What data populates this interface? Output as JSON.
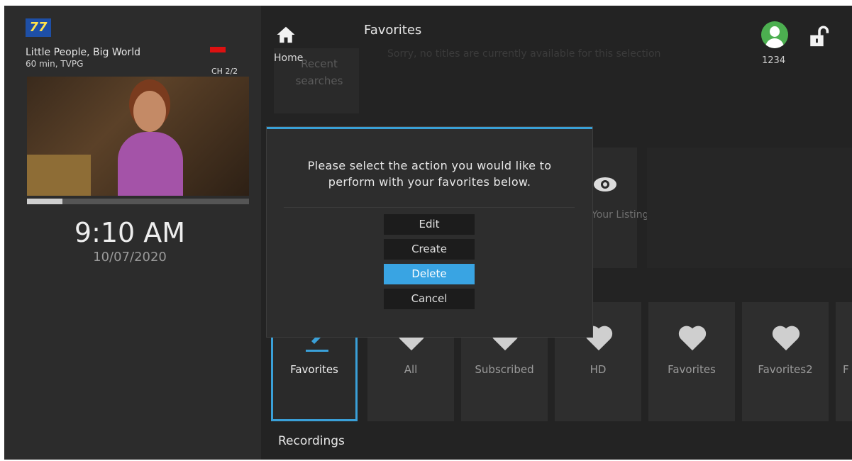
{
  "now_playing": {
    "logo_text": "77",
    "title": "Little People, Big World",
    "meta": "60 min, TVPG",
    "channel": "CH 2/2",
    "progress_fraction": 0.16
  },
  "clock": {
    "time": "9:10 AM",
    "date": "10/07/2020"
  },
  "header": {
    "home_label": "Home",
    "page_title": "Favorites",
    "user_code": "1234"
  },
  "background": {
    "recent_searches": "Recent searches",
    "sorry_message": "Sorry, no titles are currently available for this selection",
    "eye_tile_label": "Your Listings"
  },
  "favorites_row": [
    {
      "label": "Favorites",
      "icon": "pencil-icon",
      "selected": true
    },
    {
      "label": "All",
      "icon": "heart-icon"
    },
    {
      "label": "Subscribed",
      "icon": "heart-icon"
    },
    {
      "label": "HD",
      "icon": "heart-icon"
    },
    {
      "label": "Favorites",
      "icon": "heart-icon"
    },
    {
      "label": "Favorites2",
      "icon": "heart-icon"
    },
    {
      "label": "F",
      "icon": "heart-icon"
    }
  ],
  "sections": {
    "recordings": "Recordings"
  },
  "dialog": {
    "message_line1": "Please select the action you would like to",
    "message_line2": "perform with your favorites below.",
    "options": [
      "Edit",
      "Create",
      "Delete",
      "Cancel"
    ],
    "active_option": "Delete"
  },
  "colors": {
    "accent": "#39a4e3",
    "background": "#242424",
    "avatar": "#4caf50"
  }
}
